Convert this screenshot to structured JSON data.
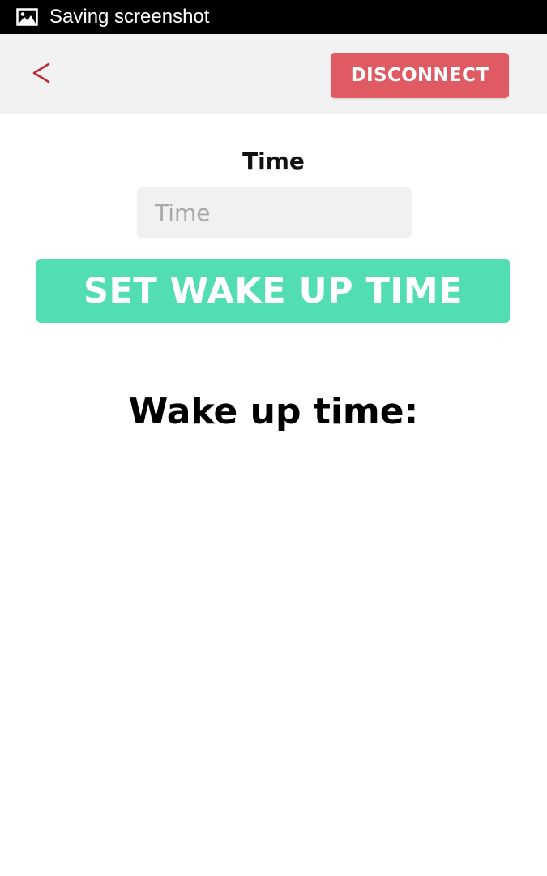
{
  "status_bar": {
    "icon": "image-icon",
    "text": "Saving screenshot"
  },
  "header": {
    "back_icon": "chevron-left-icon",
    "disconnect_label": "DISCONNECT"
  },
  "form": {
    "time_label": "Time",
    "time_placeholder": "Time",
    "time_value": "",
    "set_button_label": "SET WAKE UP TIME"
  },
  "wake_up": {
    "heading": "Wake up time:"
  },
  "colors": {
    "disconnect": "#e05a63",
    "set_button": "#52deb2",
    "back_arrow": "#c0262e"
  }
}
